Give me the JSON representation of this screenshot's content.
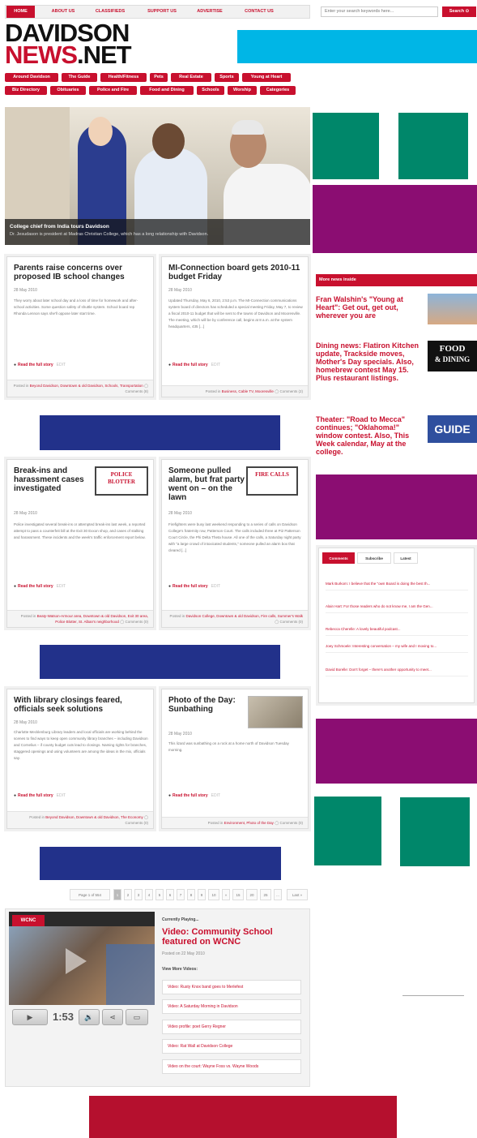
{
  "nav": {
    "items": [
      "HOME",
      "ABOUT US",
      "CLASSIFIEDS",
      "SUPPORT US",
      "ADVERTISE",
      "CONTACT US"
    ],
    "search_placeholder": "Enter your search keywords here...",
    "search_label": "Search ⊙"
  },
  "logo": {
    "line1": "DAVIDSON",
    "line2_red": "NEWS",
    "line2_black": ".NET"
  },
  "categories_row1": [
    "Around Davidson",
    "The Guide",
    "Health/Fitness",
    "Pets",
    "Real Estate",
    "Sports",
    "Young at Heart"
  ],
  "categories_row2": [
    "Biz Directory",
    "Obituaries",
    "Police and Fire",
    "Food and Dining",
    "Schools",
    "Worship",
    "Categories"
  ],
  "feature": {
    "title": "College chief from India tours Davidson",
    "subtitle": "Dr. Jesudason is president at Madras Christian College, which has a long relationship with Davidson."
  },
  "articles": [
    {
      "title": "Parents raise concerns over proposed IB school changes",
      "date": "28 May 2010",
      "body": "They worry about later school day and a loss of time for homework and after-school activities. Some question safety of shuttle system. School board rep Rhonda Lennon says she'll oppose later start time.",
      "read": "Read the full story",
      "edit": "EDIT",
      "posted": "Posted in",
      "tags": "Beyond Davidson, Downtown & old Davidson, Schools, Transportation",
      "comments": "Comments (8)"
    },
    {
      "title": "MI-Connection board gets 2010-11 budget Friday",
      "date": "28 May 2010",
      "body": "Updated Thursday, May 6, 2010, 2:53 p.m. The MI-Connection communications system board of directors has scheduled a special meeting Friday, May 7, to review a fiscal 2010-11 budget that will be sent to the towns of Davidson and Mooresville. The meeting, which will be by conference call, begins at 8 a.m. at the system headquarters, 435 [...]",
      "read": "Read the full story",
      "edit": "EDIT",
      "posted": "Posted in",
      "tags": "Business, Cable TV, Mooresville",
      "comments": "Comments (2)"
    },
    {
      "title": "Break-ins and harassment cases investigated",
      "date": "28 May 2010",
      "body": "Police investigated several break-ins or attempted break-ins last week, a reported attempt to pass a counterfeit bill at the Exit 30 Exxon shop, and cases of stalking and harassment. These incidents and the week's traffic enforcement report below.",
      "stamp": "POLICE BLOTTER",
      "read": "Read the full story",
      "edit": "EDIT",
      "posted": "Posted in",
      "tags": "Beaty-Watson-Armour area, Downtown & old Davidson, Exit 30 area, Police Blotter, St. Alban's neighborhood",
      "comments": "Comments (0)"
    },
    {
      "title": "Someone pulled alarm, but frat party went on – on the lawn",
      "date": "28 May 2010",
      "body": "Firefighters were busy last weekend responding to a series of calls on Davidson College's fraternity row, Patterson Court. The calls included three at Pi2 Patterson Court Circle, the Phi Delta Theta house. All one of the calls, a Saturday night party with \"a large crowd of intoxicated students,\" someone pulled an alarm box that cleared [...]",
      "stamp": "FIRE CALLS",
      "read": "Read the full story",
      "edit": "EDIT",
      "posted": "Posted in",
      "tags": "Davidson College, Downtown & old Davidson, Fire calls, Summer's Walk",
      "comments": "Comments (0)"
    },
    {
      "title": "With library closings feared, officials seek solutions",
      "date": "28 May 2010",
      "body": "Charlotte Mecklenburg Library leaders and local officials are working behind the scenes to find ways to keep open community library branches – including Davidson and Cornelius – if county budget cuts lead to closings. Naming rights for branches, staggered openings and using volunteers are among the ideas in the mix, officials say.",
      "read": "Read the full story",
      "edit": "EDIT",
      "posted": "Posted in",
      "tags": "Beyond Davidson, Downtown & old Davidson, The Economy",
      "comments": "Comments (0)"
    },
    {
      "title": "Photo of the Day: Sunbathing",
      "date": "28 May 2010",
      "body": "This lizard was sunbathing on a rock at a home north of Davidson Tuesday morning.",
      "read": "Read the full story",
      "edit": "EDIT",
      "posted": "Posted in",
      "tags": "Environment, Photo of the Day",
      "comments": "Comments (0)"
    }
  ],
  "sidebar": {
    "more_header": "More news inside",
    "items": [
      "Fran Walshin's \"Young at Heart\": Get out, get out, wherever you are",
      "Dining news: Flatiron Kitchen update, Trackside moves, Mother's Day specials. Also, homebrew contest May 15. Plus restaurant listings.",
      "Theater: \"Road to Mecca\" continues; \"Oklahoma!\" window contest. Also, This Week calendar, May at the college."
    ],
    "food_thumb_line1": "FOOD",
    "food_thumb_line2": "& DINING",
    "guide_thumb": "GUIDE"
  },
  "comments_widget": {
    "tabs": [
      "Comments",
      "Subscribe",
      "Latest"
    ],
    "items": [
      "Mark Burkom: I believe that the \"own Board is doing the best th...",
      "Alain Hart: For those readers who do not know me, I am the Gen...",
      "Rebecca Cherelle: A lovely beautiful podcast...",
      "Joey Schmoele: Interesting conversation – my wife and I moving to...",
      "David Borelle: Don't forget – there's another opportunity to meet..."
    ]
  },
  "pagination": {
    "label": "Page 1 of 554",
    "pages": [
      "1",
      "2",
      "3",
      "4",
      "5",
      "6",
      "7",
      "8",
      "9",
      "10",
      "»",
      "15",
      "20",
      "25",
      "...",
      "Last »"
    ]
  },
  "video": {
    "logo": "WCNC",
    "time": "1:53",
    "now_playing_label": "Currently Playing...",
    "title": "Video: Community School featured on WCNC",
    "posted": "Posted on 22 May 2010",
    "more_label": "View More Videos:",
    "links": [
      "Video: Rusty Knox band goes to Merlefest",
      "Video: A Saturday Morning in Davidson",
      "Video profile: poet Gerry Regner",
      "Video: Rat Wall at Davidson College",
      "Video on the court: Wayne Foss vs. Wayne Woods"
    ]
  },
  "colors": {
    "brand_red": "#c8102e",
    "ad_cyan": "#00b6e6",
    "ad_green": "#00876a",
    "ad_purple": "#8b0d72",
    "ad_navy": "#22318a",
    "ad_red": "#b5102e"
  }
}
